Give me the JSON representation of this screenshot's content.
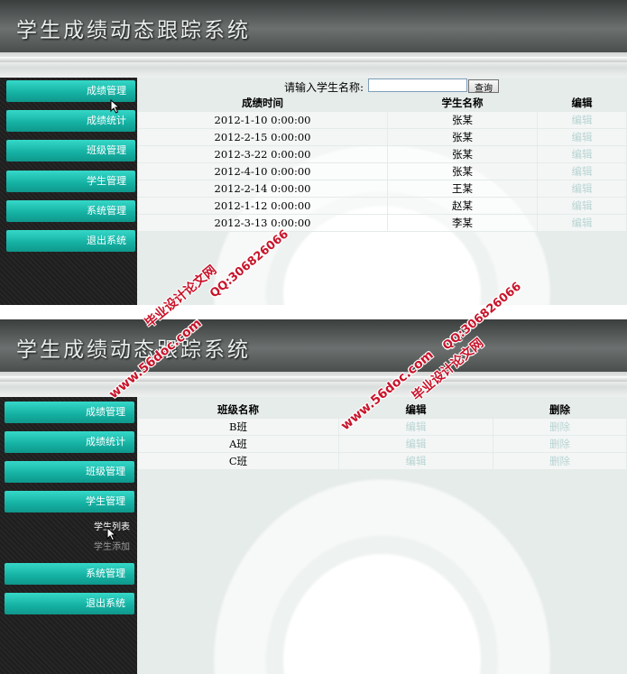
{
  "app": {
    "title": "学生成绩动态跟踪系统"
  },
  "panel1": {
    "nav": [
      "成绩管理",
      "成绩统计",
      "班级管理",
      "学生管理",
      "系统管理",
      "退出系统"
    ],
    "search": {
      "label": "请输入学生名称:",
      "value": "",
      "button": "查询"
    },
    "table": {
      "headers": [
        "成绩时间",
        "学生名称",
        "编辑"
      ],
      "rows": [
        {
          "time": "2012-1-10 0:00:00",
          "name": "张某",
          "action": "编辑"
        },
        {
          "time": "2012-2-15 0:00:00",
          "name": "张某",
          "action": "编辑"
        },
        {
          "time": "2012-3-22 0:00:00",
          "name": "张某",
          "action": "编辑"
        },
        {
          "time": "2012-4-10 0:00:00",
          "name": "张某",
          "action": "编辑"
        },
        {
          "time": "2012-2-14 0:00:00",
          "name": "王某",
          "action": "编辑"
        },
        {
          "time": "2012-1-12 0:00:00",
          "name": "赵某",
          "action": "编辑"
        },
        {
          "time": "2012-3-13 0:00:00",
          "name": "李某",
          "action": "编辑"
        }
      ]
    }
  },
  "panel2": {
    "nav": [
      "成绩管理",
      "成绩统计",
      "班级管理",
      "学生管理",
      "系统管理",
      "退出系统"
    ],
    "submenu": [
      "学生列表",
      "学生添加"
    ],
    "table": {
      "headers": [
        "班级名称",
        "编辑",
        "删除"
      ],
      "rows": [
        {
          "name": "B班",
          "edit": "编辑",
          "delete": "删除"
        },
        {
          "name": "A班",
          "edit": "编辑",
          "delete": "删除"
        },
        {
          "name": "C班",
          "edit": "编辑",
          "delete": "删除"
        }
      ]
    }
  },
  "watermarks": {
    "site": "www.56doc.com",
    "name": "毕业设计论文网",
    "qq": "QQ:306826066"
  },
  "colors": {
    "accent": "#14b0a2",
    "link": "#b8d4d2",
    "watermark": "#c8142a"
  }
}
